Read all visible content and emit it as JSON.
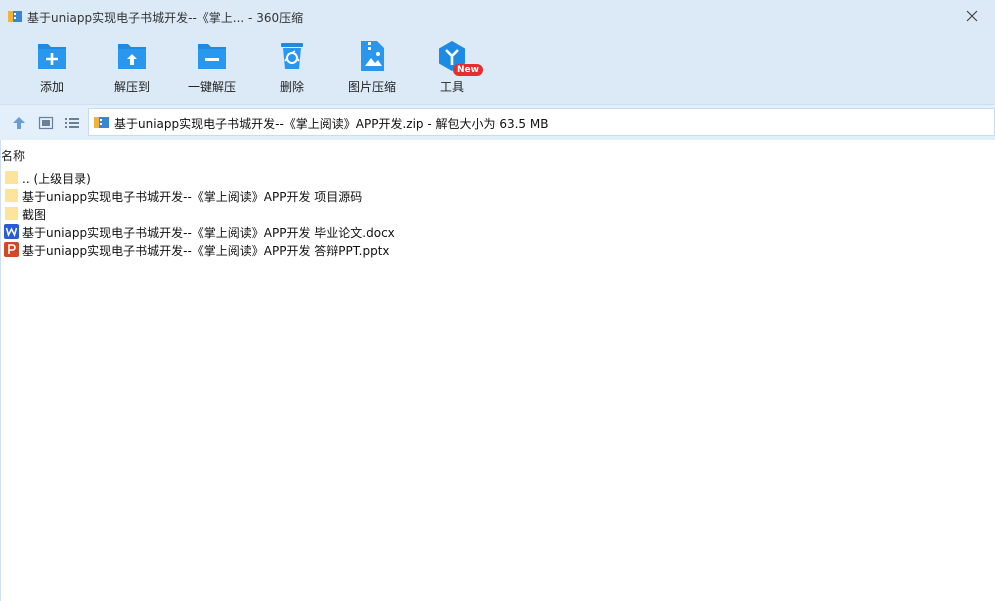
{
  "window": {
    "title": "基于uniapp实现电子书城开发--《掌上... - 360压缩"
  },
  "toolbar": {
    "items": [
      {
        "label": "添加",
        "icon": "add-folder-icon"
      },
      {
        "label": "解压到",
        "icon": "extract-to-icon"
      },
      {
        "label": "一键解压",
        "icon": "one-click-extract-icon"
      },
      {
        "label": "删除",
        "icon": "delete-bin-icon"
      },
      {
        "label": "图片压缩",
        "icon": "image-compress-icon"
      },
      {
        "label": "工具",
        "icon": "tools-icon"
      }
    ],
    "new_badge": "New"
  },
  "address": {
    "path": "基于uniapp实现电子书城开发--《掌上阅读》APP开发.zip - 解包大小为 63.5 MB"
  },
  "list": {
    "column_name": "名称",
    "files": [
      {
        "name": ".. (上级目录)",
        "type": "folder"
      },
      {
        "name": "基于uniapp实现电子书城开发--《掌上阅读》APP开发 项目源码",
        "type": "folder"
      },
      {
        "name": "截图",
        "type": "folder"
      },
      {
        "name": "基于uniapp实现电子书城开发--《掌上阅读》APP开发 毕业论文.docx",
        "type": "word"
      },
      {
        "name": "基于uniapp实现电子书城开发--《掌上阅读》APP开发 答辩PPT.pptx",
        "type": "powerpoint"
      }
    ]
  },
  "colors": {
    "accent": "#1d8ae3",
    "chrome": "#dceaf8",
    "folder": "#fcd97a",
    "word": "#2a5bd7",
    "powerpoint": "#d24726",
    "badge": "#e62e2e"
  }
}
